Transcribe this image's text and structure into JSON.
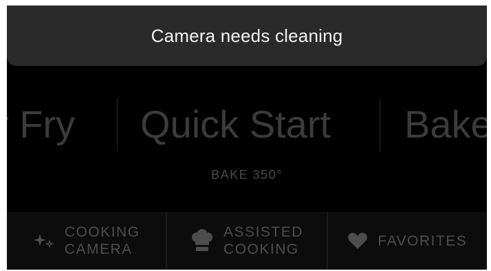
{
  "toast": {
    "message": "Camera needs cleaning"
  },
  "carousel": {
    "modes": [
      "r Fry",
      "Quick Start",
      "Bake"
    ],
    "subtitle": "BAKE 350°"
  },
  "bottom_nav": [
    {
      "line1": "COOKING",
      "line2": "CAMERA",
      "icon": "sparkle-icon"
    },
    {
      "line1": "ASSISTED",
      "line2": "COOKING",
      "icon": "chef-hat-icon"
    },
    {
      "line1": "FAVORITES",
      "icon": "heart-icon"
    }
  ],
  "colors": {
    "background": "#000000",
    "toast_bg": "#2a2a2a",
    "toast_text": "#f2f2f2",
    "dim_text": "#3b3b3b"
  }
}
